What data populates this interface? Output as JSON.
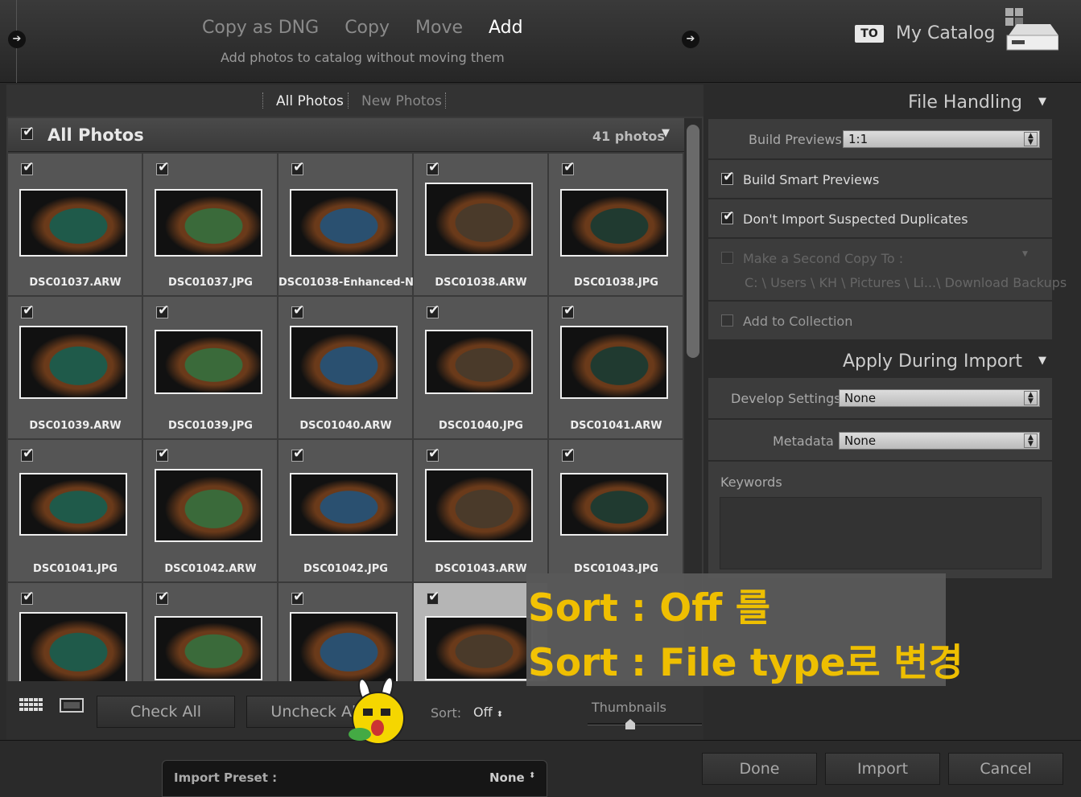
{
  "header": {
    "modes": [
      "Copy as DNG",
      "Copy",
      "Move",
      "Add"
    ],
    "active_mode": "Add",
    "subtitle": "Add photos to catalog without moving them",
    "to_badge": "TO",
    "destination": "My Catalog"
  },
  "tabs": {
    "all": "All Photos",
    "new": "New Photos"
  },
  "grid_header": {
    "title": "All Photos",
    "count": "41 photos"
  },
  "photos": [
    {
      "name": "DSC01037.ARW",
      "checked": true
    },
    {
      "name": "DSC01037.JPG",
      "checked": true
    },
    {
      "name": "DSC01038-Enhanced-N...",
      "checked": true
    },
    {
      "name": "DSC01038.ARW",
      "checked": true
    },
    {
      "name": "DSC01038.JPG",
      "checked": true
    },
    {
      "name": "DSC01039.ARW",
      "checked": true
    },
    {
      "name": "DSC01039.JPG",
      "checked": true
    },
    {
      "name": "DSC01040.ARW",
      "checked": true
    },
    {
      "name": "DSC01040.JPG",
      "checked": true
    },
    {
      "name": "DSC01041.ARW",
      "checked": true
    },
    {
      "name": "DSC01041.JPG",
      "checked": true
    },
    {
      "name": "DSC01042.ARW",
      "checked": true
    },
    {
      "name": "DSC01042.JPG",
      "checked": true
    },
    {
      "name": "DSC01043.ARW",
      "checked": true
    },
    {
      "name": "DSC01043.JPG",
      "checked": true
    },
    {
      "name": "",
      "checked": true
    },
    {
      "name": "",
      "checked": true
    },
    {
      "name": "",
      "checked": true
    },
    {
      "name": "",
      "checked": true
    }
  ],
  "toolbar": {
    "check_all": "Check All",
    "uncheck_all": "Uncheck All",
    "sort_label": "Sort:",
    "sort_value": "Off",
    "thumbnails_label": "Thumbnails"
  },
  "file_handling": {
    "title": "File Handling",
    "build_previews_label": "Build Previews",
    "build_previews_value": "1:1",
    "build_smart_previews": "Build Smart Previews",
    "dont_import_duplicates": "Don't Import Suspected Duplicates",
    "second_copy_label": "Make a Second Copy To :",
    "second_copy_path": "C: \\ Users \\ KH \\ Pictures \\ Li...\\ Download Backups",
    "add_to_collection": "Add to Collection"
  },
  "apply_during_import": {
    "title": "Apply During Import",
    "develop_label": "Develop Settings",
    "develop_value": "None",
    "metadata_label": "Metadata",
    "metadata_value": "None",
    "keywords_label": "Keywords"
  },
  "footer": {
    "preset_label": "Import Preset :",
    "preset_value": "None",
    "done": "Done",
    "import": "Import",
    "cancel": "Cancel"
  },
  "annotation": {
    "line1": "Sort : Off 를",
    "line2": "Sort : File type로 변경",
    "color": "#f5c400"
  }
}
